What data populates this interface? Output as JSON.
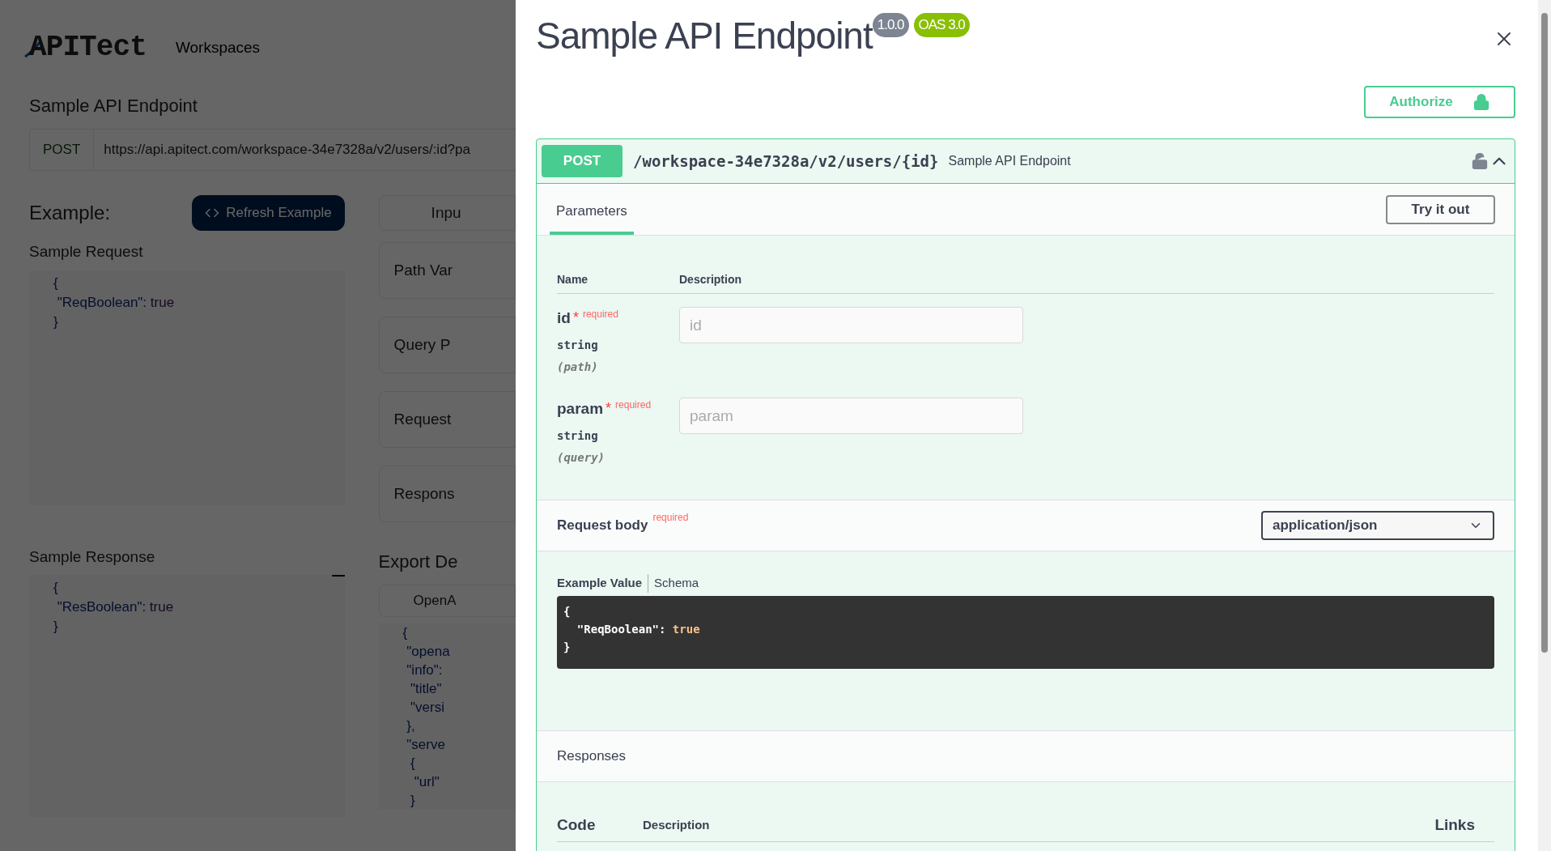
{
  "background": {
    "logo": "APITect",
    "nav": "Workspaces",
    "title": "Sample API Endpoint",
    "method": "POST",
    "url": "https://api.apitect.com/workspace-34e7328a/v2/users/:id?pa",
    "example_heading": "Example:",
    "refresh_button": "Refresh Example",
    "sample_request": {
      "heading": "Sample Request",
      "lines": [
        {
          "text": "{"
        },
        {
          "text": " \"ReqBoolean\": ",
          "value": "true"
        },
        {
          "text": "}"
        }
      ]
    },
    "sample_response": {
      "heading": "Sample Response",
      "lines": [
        {
          "text": "{"
        },
        {
          "text": " \"ResBoolean\": ",
          "value": "true"
        },
        {
          "text": "}"
        }
      ]
    },
    "side_cards": [
      "Inpu",
      "Path Var",
      "Query P",
      "Request",
      "Respons"
    ],
    "export_heading": "Export De",
    "export_tab": "OpenA",
    "export_code": [
      "{",
      " \"opena",
      " \"info\":",
      "  \"title\"",
      "  \"versi",
      " },",
      " \"serve",
      "  {",
      "   \"url\"",
      "  }"
    ]
  },
  "panel": {
    "title": "Sample API Endpoint",
    "badges": [
      {
        "text": "1.0.0",
        "color": "#7d8492"
      },
      {
        "text": "OAS 3.0",
        "color": "#89bf04"
      }
    ],
    "authorize_button": "Authorize",
    "operation": {
      "method": "POST",
      "path": "/workspace-34e7328a/v2/users/{id}",
      "summary": "Sample API Endpoint",
      "expanded": true,
      "tabs": [
        {
          "label": "Parameters",
          "selected": true
        }
      ],
      "try_button": "Try it out",
      "param_columns": [
        "Name",
        "Description"
      ],
      "params": [
        {
          "name": "id",
          "required_mark": "*",
          "required_label": "required",
          "type": "string",
          "location": "(path)",
          "placeholder": "id"
        },
        {
          "name": "param",
          "required_mark": "*",
          "required_label": "required",
          "type": "string",
          "location": "(query)",
          "placeholder": "param"
        }
      ],
      "request_body": {
        "label": "Request body",
        "required_label": "required",
        "content_type": "application/json",
        "tabs": [
          {
            "label": "Example Value",
            "selected": true
          },
          {
            "label": "Schema",
            "selected": false
          }
        ],
        "code": [
          {
            "text": "{"
          },
          {
            "text": "  \"ReqBoolean\": ",
            "value": "true"
          },
          {
            "text": "}"
          }
        ]
      },
      "responses": {
        "heading": "Responses",
        "columns": [
          "Code",
          "Description",
          "Links"
        ]
      }
    }
  }
}
